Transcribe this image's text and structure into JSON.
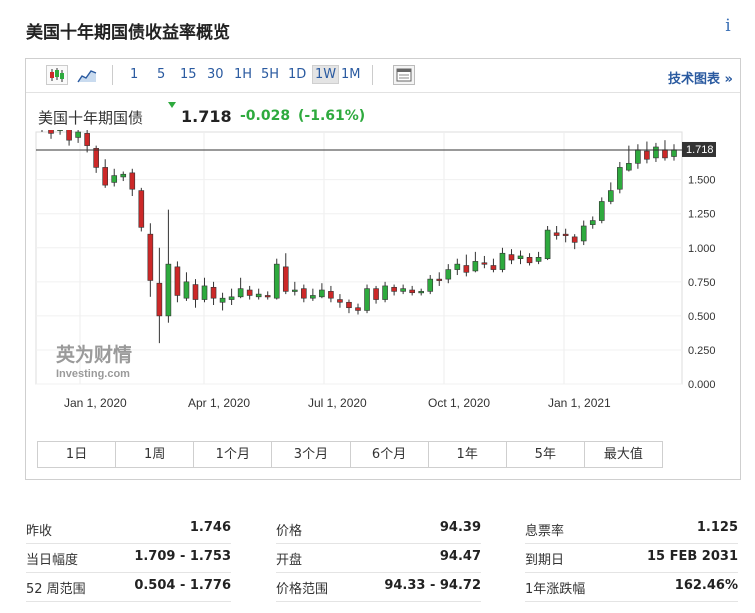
{
  "page": {
    "title": "美国十年期国债收益率概览",
    "info_icon": "i"
  },
  "toolbar": {
    "icons": [
      "candlestick-icon",
      "area-chart-icon",
      "table-icon"
    ],
    "intervals": [
      "1",
      "5",
      "15",
      "30",
      "1H",
      "5H",
      "1D",
      "1W",
      "1M"
    ],
    "selected_interval": "1W",
    "tech_chart_label": "技术图表 »"
  },
  "quote": {
    "name": "美国十年期国债",
    "last": "1.718",
    "change": "-0.028",
    "change_pct": "(-1.61%)",
    "up_color": "#2eaa3e",
    "down_color": "#cc2828"
  },
  "chart_data": {
    "type": "candlestick",
    "ylim": [
      0.0,
      1.85
    ],
    "yticks": [
      "0.000",
      "0.250",
      "0.500",
      "0.750",
      "1.000",
      "1.250",
      "1.500"
    ],
    "xtick_labels": [
      "Jan 1, 2020",
      "Apr 1, 2020",
      "Jul 1, 2020",
      "Oct 1, 2020",
      "Jan 1, 2021"
    ],
    "last_price_label": "1.718",
    "last_price": 1.718,
    "watermark": {
      "cn": "英为财情",
      "en": "Investing.com"
    },
    "candles": [
      [
        1.92,
        1.89,
        1.94,
        1.85
      ],
      [
        1.9,
        1.84,
        1.96,
        1.8
      ],
      [
        1.86,
        1.94,
        1.98,
        1.83
      ],
      [
        1.92,
        1.79,
        1.95,
        1.75
      ],
      [
        1.81,
        1.85,
        1.9,
        1.77
      ],
      [
        1.84,
        1.75,
        1.87,
        1.7
      ],
      [
        1.73,
        1.59,
        1.75,
        1.55
      ],
      [
        1.59,
        1.46,
        1.65,
        1.44
      ],
      [
        1.48,
        1.53,
        1.58,
        1.45
      ],
      [
        1.52,
        1.54,
        1.56,
        1.49
      ],
      [
        1.55,
        1.43,
        1.58,
        1.38
      ],
      [
        1.42,
        1.15,
        1.44,
        1.12
      ],
      [
        1.1,
        0.76,
        1.18,
        0.64
      ],
      [
        0.74,
        0.5,
        1.0,
        0.3
      ],
      [
        0.5,
        0.88,
        1.28,
        0.45
      ],
      [
        0.86,
        0.65,
        0.9,
        0.6
      ],
      [
        0.63,
        0.75,
        0.82,
        0.61
      ],
      [
        0.73,
        0.62,
        0.77,
        0.56
      ],
      [
        0.62,
        0.72,
        0.78,
        0.6
      ],
      [
        0.71,
        0.63,
        0.75,
        0.58
      ],
      [
        0.6,
        0.63,
        0.67,
        0.54
      ],
      [
        0.62,
        0.64,
        0.7,
        0.58
      ],
      [
        0.64,
        0.7,
        0.78,
        0.63
      ],
      [
        0.69,
        0.65,
        0.72,
        0.62
      ],
      [
        0.64,
        0.66,
        0.7,
        0.62
      ],
      [
        0.65,
        0.64,
        0.68,
        0.62
      ],
      [
        0.63,
        0.88,
        0.92,
        0.62
      ],
      [
        0.86,
        0.68,
        0.96,
        0.66
      ],
      [
        0.68,
        0.69,
        0.75,
        0.65
      ],
      [
        0.7,
        0.63,
        0.73,
        0.6
      ],
      [
        0.63,
        0.65,
        0.7,
        0.61
      ],
      [
        0.64,
        0.69,
        0.74,
        0.63
      ],
      [
        0.68,
        0.63,
        0.72,
        0.6
      ],
      [
        0.62,
        0.6,
        0.66,
        0.56
      ],
      [
        0.6,
        0.56,
        0.62,
        0.52
      ],
      [
        0.56,
        0.54,
        0.59,
        0.51
      ],
      [
        0.54,
        0.7,
        0.73,
        0.52
      ],
      [
        0.7,
        0.62,
        0.72,
        0.59
      ],
      [
        0.62,
        0.72,
        0.75,
        0.6
      ],
      [
        0.71,
        0.68,
        0.73,
        0.65
      ],
      [
        0.68,
        0.7,
        0.73,
        0.66
      ],
      [
        0.69,
        0.67,
        0.72,
        0.65
      ],
      [
        0.67,
        0.68,
        0.7,
        0.65
      ],
      [
        0.68,
        0.77,
        0.8,
        0.66
      ],
      [
        0.77,
        0.76,
        0.82,
        0.72
      ],
      [
        0.77,
        0.84,
        0.88,
        0.74
      ],
      [
        0.84,
        0.88,
        0.92,
        0.8
      ],
      [
        0.87,
        0.82,
        0.95,
        0.79
      ],
      [
        0.83,
        0.9,
        0.97,
        0.82
      ],
      [
        0.89,
        0.88,
        0.94,
        0.85
      ],
      [
        0.87,
        0.84,
        0.92,
        0.82
      ],
      [
        0.84,
        0.96,
        1.0,
        0.82
      ],
      [
        0.95,
        0.91,
        0.99,
        0.88
      ],
      [
        0.92,
        0.94,
        0.98,
        0.88
      ],
      [
        0.93,
        0.89,
        0.96,
        0.87
      ],
      [
        0.9,
        0.93,
        0.97,
        0.88
      ],
      [
        0.92,
        1.13,
        1.16,
        0.91
      ],
      [
        1.11,
        1.09,
        1.16,
        1.06
      ],
      [
        1.1,
        1.09,
        1.14,
        1.04
      ],
      [
        1.08,
        1.04,
        1.1,
        0.99
      ],
      [
        1.05,
        1.16,
        1.2,
        1.02
      ],
      [
        1.17,
        1.2,
        1.23,
        1.14
      ],
      [
        1.2,
        1.34,
        1.37,
        1.18
      ],
      [
        1.34,
        1.42,
        1.48,
        1.32
      ],
      [
        1.43,
        1.59,
        1.63,
        1.4
      ],
      [
        1.57,
        1.62,
        1.75,
        1.56
      ],
      [
        1.62,
        1.72,
        1.76,
        1.58
      ],
      [
        1.71,
        1.65,
        1.78,
        1.62
      ],
      [
        1.66,
        1.74,
        1.77,
        1.63
      ],
      [
        1.72,
        1.66,
        1.79,
        1.64
      ],
      [
        1.67,
        1.72,
        1.76,
        1.64
      ]
    ]
  },
  "ranges": [
    "1日",
    "1周",
    "1个月",
    "3个月",
    "6个月",
    "1年",
    "5年",
    "最大值"
  ],
  "stats": {
    "col1": [
      {
        "label": "昨收",
        "value": "1.746"
      },
      {
        "label": "当日幅度",
        "value": "1.709 - 1.753"
      },
      {
        "label": "52 周范围",
        "value": "0.504 - 1.776"
      }
    ],
    "col2": [
      {
        "label": "价格",
        "value": "94.39"
      },
      {
        "label": "开盘",
        "value": "94.47"
      },
      {
        "label": "价格范围",
        "value": "94.33 - 94.72"
      }
    ],
    "col3": [
      {
        "label": "息票率",
        "value": "1.125"
      },
      {
        "label": "到期日",
        "value": "15 FEB 2031"
      },
      {
        "label": "1年涨跌幅",
        "value": "162.46%"
      }
    ]
  }
}
